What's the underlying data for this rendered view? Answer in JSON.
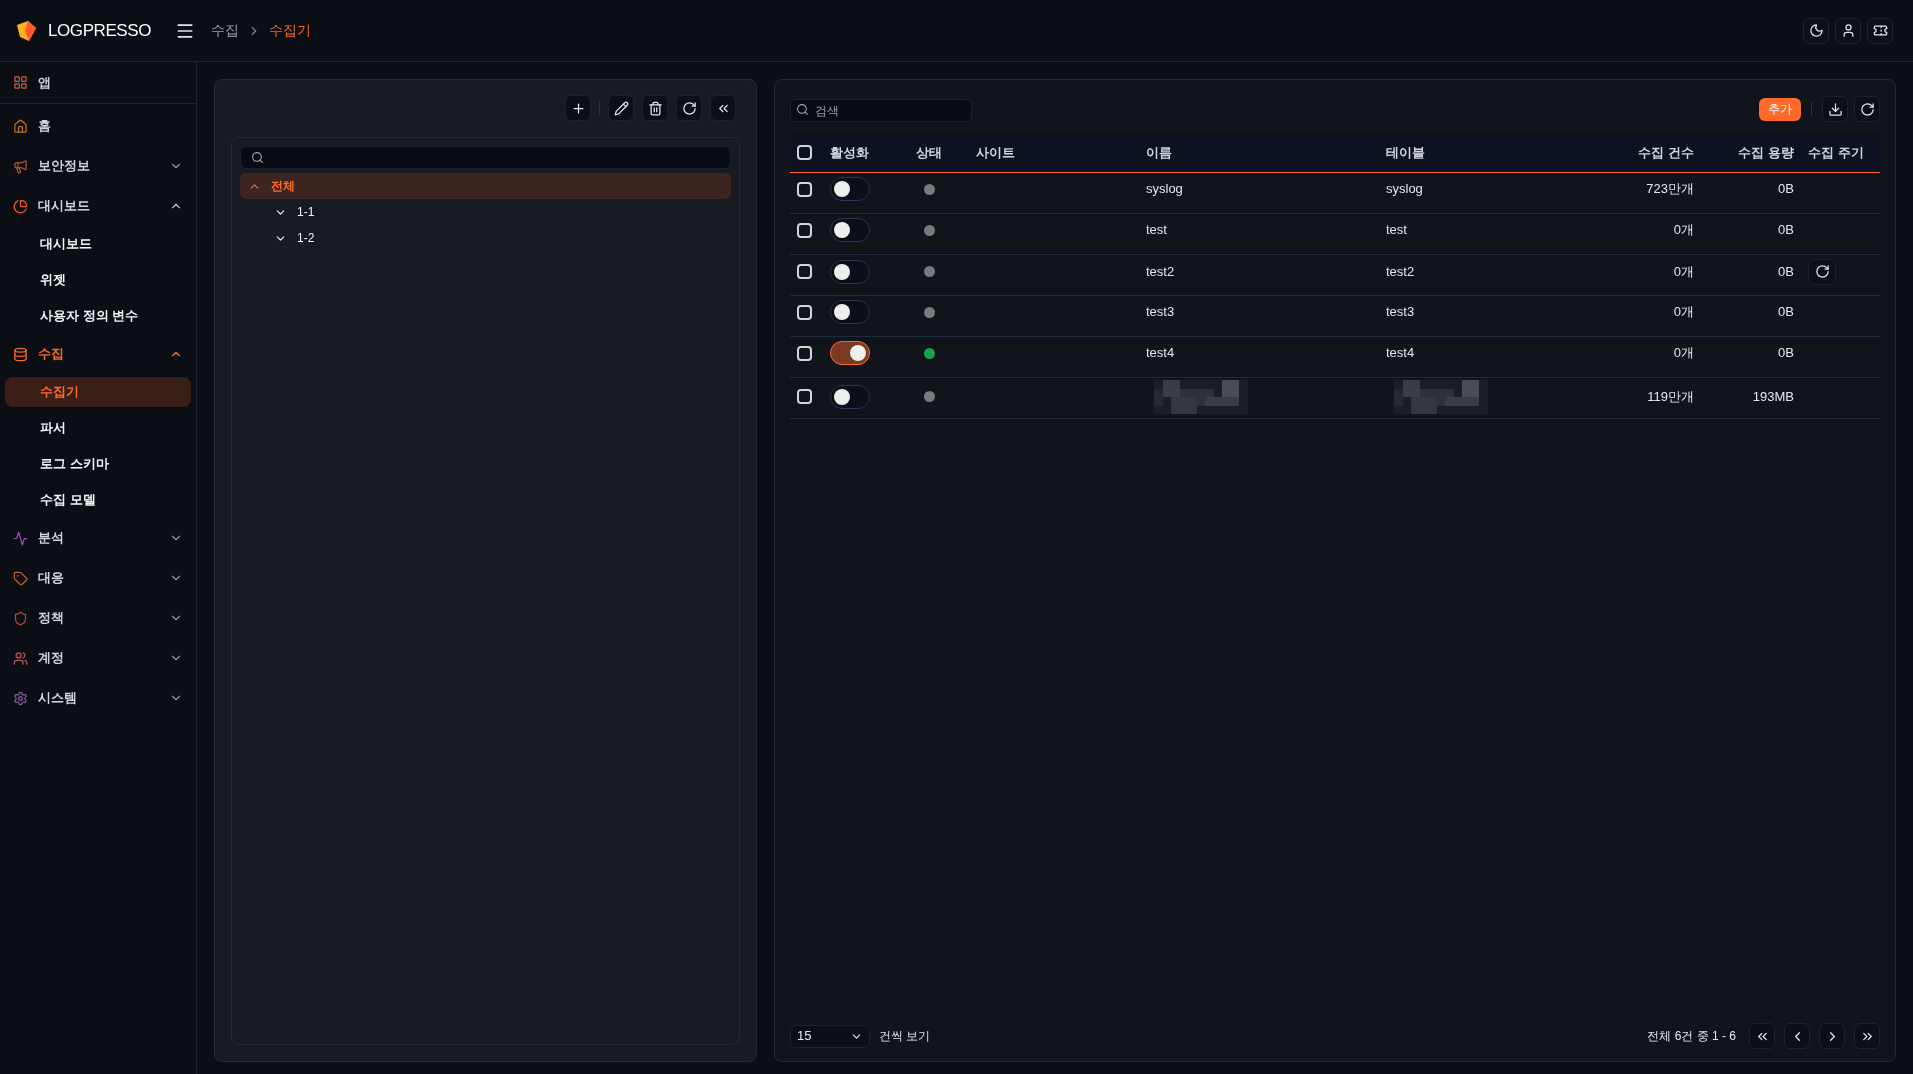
{
  "header": {
    "logo": "LOGPRESSO",
    "breadcrumb": [
      {
        "label": "수집",
        "selected": false
      },
      {
        "label": "수집기",
        "selected": true
      }
    ]
  },
  "sidebar": {
    "apps": "앱",
    "items": [
      {
        "label": "홈",
        "selected": false
      },
      {
        "label": "보안정보",
        "selected": false,
        "expanded": false
      },
      {
        "label": "대시보드",
        "selected": false,
        "expanded": true,
        "children": [
          {
            "label": "대시보드",
            "selected": false
          },
          {
            "label": "위젯",
            "selected": false
          },
          {
            "label": "사용자 정의 변수",
            "selected": false
          }
        ]
      },
      {
        "label": "수집",
        "selected": true,
        "expanded": true,
        "children": [
          {
            "label": "수집기",
            "selected": true
          },
          {
            "label": "파서",
            "selected": false
          },
          {
            "label": "로그 스키마",
            "selected": false
          },
          {
            "label": "수집 모델",
            "selected": false
          }
        ]
      },
      {
        "label": "분석",
        "selected": false,
        "expanded": false
      },
      {
        "label": "대응",
        "selected": false,
        "expanded": false
      },
      {
        "label": "정책",
        "selected": false,
        "expanded": false
      },
      {
        "label": "계정",
        "selected": false,
        "expanded": false
      },
      {
        "label": "시스템",
        "selected": false,
        "expanded": false
      }
    ]
  },
  "tree": {
    "nodes": [
      {
        "label": "전체",
        "selected": true,
        "expanded": true,
        "children": [
          {
            "label": "1-1",
            "selected": false,
            "expanded": false
          },
          {
            "label": "1-2",
            "selected": false,
            "expanded": false
          }
        ]
      }
    ]
  },
  "table": {
    "search": {
      "placeholder": "검색"
    },
    "add_button": "추가",
    "all_checked": false,
    "columns": [
      "활성화",
      "상태",
      "사이트",
      "이름",
      "테이블",
      "수집 건수",
      "수집 용량",
      "수집 주기"
    ],
    "rows": [
      {
        "checked": false,
        "on": false,
        "color": "#7a7a7a",
        "name": "syslog",
        "table": "syslog",
        "count": "723만개",
        "size": "0B",
        "cycle_button": false,
        "redacted": false
      },
      {
        "checked": false,
        "on": false,
        "color": "#7a7a7a",
        "name": "test",
        "table": "test",
        "count": "0개",
        "size": "0B",
        "cycle_button": false,
        "redacted": false
      },
      {
        "checked": false,
        "on": false,
        "color": "#7a7a7a",
        "name": "test2",
        "table": "test2",
        "count": "0개",
        "size": "0B",
        "cycle_button": true,
        "redacted": false
      },
      {
        "checked": false,
        "on": false,
        "color": "#7a7a7a",
        "name": "test3",
        "table": "test3",
        "count": "0개",
        "size": "0B",
        "cycle_button": false,
        "redacted": false
      },
      {
        "checked": false,
        "on": true,
        "color": "#16a34a",
        "name": "test4",
        "table": "test4",
        "count": "0개",
        "size": "0B",
        "cycle_button": false,
        "redacted": false
      },
      {
        "checked": false,
        "on": false,
        "color": "#7a7a7a",
        "count": "119만개",
        "size": "193MB",
        "cycle_button": false,
        "redacted": true
      }
    ]
  },
  "footer": {
    "page_size": "15",
    "page_size_label": "건씩 보기",
    "summary": "전체 6건 중 1 - 6"
  }
}
